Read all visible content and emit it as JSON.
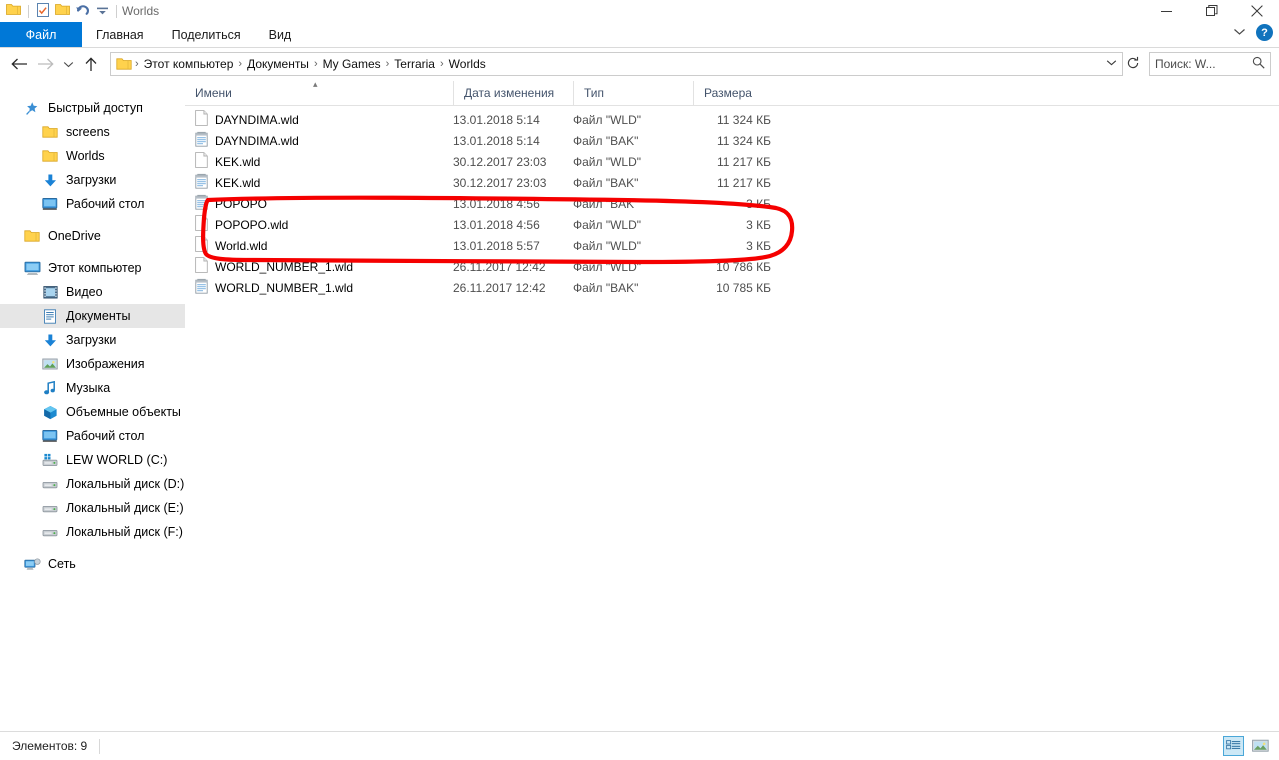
{
  "window": {
    "title": "Worlds",
    "quick_access": [
      "folder-icon",
      "properties-icon",
      "new-folder-icon",
      "undo-icon",
      "customize-dropdown-icon"
    ],
    "controls": {
      "minimize": "—",
      "restore": "restore-icon",
      "close": "✕"
    },
    "ribbon_collapse": "⌄",
    "help": "?"
  },
  "ribbon": {
    "tabs": [
      {
        "label": "Файл",
        "active": true
      },
      {
        "label": "Главная",
        "active": false
      },
      {
        "label": "Поделиться",
        "active": false
      },
      {
        "label": "Вид",
        "active": false
      }
    ]
  },
  "address": {
    "back": "←",
    "forward": "→",
    "recent": "⌄",
    "up": "↑",
    "crumbs": [
      "Этот компьютер",
      "Документы",
      "My Games",
      "Terraria",
      "Worlds"
    ],
    "separator": "›",
    "dropdown": "⌄",
    "refresh": "↻"
  },
  "search": {
    "placeholder": "Поиск: W...",
    "icon": "search-icon"
  },
  "sidebar": {
    "groups": [
      {
        "items": [
          {
            "label": "Быстрый доступ",
            "icon": "star-pin-icon",
            "level": 0,
            "selected": false
          },
          {
            "label": "screens",
            "icon": "folder-icon",
            "level": 1,
            "selected": false
          },
          {
            "label": "Worlds",
            "icon": "folder-icon",
            "level": 1,
            "selected": false
          },
          {
            "label": "Загрузки",
            "icon": "download-icon",
            "level": 1,
            "selected": false
          },
          {
            "label": "Рабочий стол",
            "icon": "desktop-icon",
            "level": 1,
            "selected": false
          }
        ]
      },
      {
        "items": [
          {
            "label": "OneDrive",
            "icon": "onedrive-folder-icon",
            "level": 0,
            "selected": false
          }
        ]
      },
      {
        "items": [
          {
            "label": "Этот компьютер",
            "icon": "this-pc-icon",
            "level": 0,
            "selected": false
          },
          {
            "label": "Видео",
            "icon": "video-icon",
            "level": 1,
            "selected": false
          },
          {
            "label": "Документы",
            "icon": "documents-icon",
            "level": 1,
            "selected": true
          },
          {
            "label": "Загрузки",
            "icon": "download-icon",
            "level": 1,
            "selected": false
          },
          {
            "label": "Изображения",
            "icon": "pictures-icon",
            "level": 1,
            "selected": false
          },
          {
            "label": "Музыка",
            "icon": "music-icon",
            "level": 1,
            "selected": false
          },
          {
            "label": "Объемные объекты",
            "icon": "3d-objects-icon",
            "level": 1,
            "selected": false
          },
          {
            "label": "Рабочий стол",
            "icon": "desktop-icon",
            "level": 1,
            "selected": false
          },
          {
            "label": "LEW WORLD (C:)",
            "icon": "system-drive-icon",
            "level": 1,
            "selected": false
          },
          {
            "label": "Локальный диск (D:)",
            "icon": "drive-icon",
            "level": 1,
            "selected": false
          },
          {
            "label": "Локальный диск (E:)",
            "icon": "drive-icon",
            "level": 1,
            "selected": false
          },
          {
            "label": "Локальный диск (F:)",
            "icon": "drive-icon",
            "level": 1,
            "selected": false
          }
        ]
      },
      {
        "items": [
          {
            "label": "Сеть",
            "icon": "network-icon",
            "level": 0,
            "selected": false
          }
        ]
      }
    ]
  },
  "file_list": {
    "columns": [
      {
        "label": "Имени",
        "sorted": "asc"
      },
      {
        "label": "Дата изменения",
        "sorted": ""
      },
      {
        "label": "Тип",
        "sorted": ""
      },
      {
        "label": "Размера",
        "sorted": ""
      }
    ],
    "sort_caret": "▴",
    "rows": [
      {
        "name": "DAYNDIMA.wld",
        "icon": "wld-file-icon",
        "date": "13.01.2018 5:14",
        "type": "Файл \"WLD\"",
        "size": "11 324 КБ",
        "highlighted": false
      },
      {
        "name": "DAYNDIMA.wld",
        "icon": "bak-file-icon",
        "date": "13.01.2018 5:14",
        "type": "Файл \"BAK\"",
        "size": "11 324 КБ",
        "highlighted": false
      },
      {
        "name": "KEK.wld",
        "icon": "wld-file-icon",
        "date": "30.12.2017 23:03",
        "type": "Файл \"WLD\"",
        "size": "11 217 КБ",
        "highlighted": false
      },
      {
        "name": "KEK.wld",
        "icon": "bak-file-icon",
        "date": "30.12.2017 23:03",
        "type": "Файл \"BAK\"",
        "size": "11 217 КБ",
        "highlighted": false
      },
      {
        "name": "POPOPO",
        "icon": "bak-file-icon",
        "date": "13.01.2018 4:56",
        "type": "Файл \"BAK\"",
        "size": "3 КБ",
        "highlighted": true
      },
      {
        "name": "POPOPO.wld",
        "icon": "wld-file-icon",
        "date": "13.01.2018 4:56",
        "type": "Файл \"WLD\"",
        "size": "3 КБ",
        "highlighted": true
      },
      {
        "name": "World.wld",
        "icon": "wld-file-icon",
        "date": "13.01.2018 5:57",
        "type": "Файл \"WLD\"",
        "size": "3 КБ",
        "highlighted": true
      },
      {
        "name": "WORLD_NUMBER_1.wld",
        "icon": "wld-file-icon",
        "date": "26.11.2017 12:42",
        "type": "Файл \"WLD\"",
        "size": "10 786 КБ",
        "highlighted": false
      },
      {
        "name": "WORLD_NUMBER_1.wld",
        "icon": "bak-file-icon",
        "date": "26.11.2017 12:42",
        "type": "Файл \"BAK\"",
        "size": "10 785 КБ",
        "highlighted": false
      }
    ]
  },
  "statusbar": {
    "items_text": "Элементов: 9",
    "views": [
      {
        "name": "details-view",
        "active": true
      },
      {
        "name": "large-icons-view",
        "active": false
      }
    ]
  },
  "annotation": {
    "color": "#f50000",
    "shape": "hand-drawn-oval",
    "stroke_width": 4
  },
  "colors": {
    "accent": "#0078d7",
    "selection": "#cce8f6",
    "annotation_red": "#f50000"
  }
}
